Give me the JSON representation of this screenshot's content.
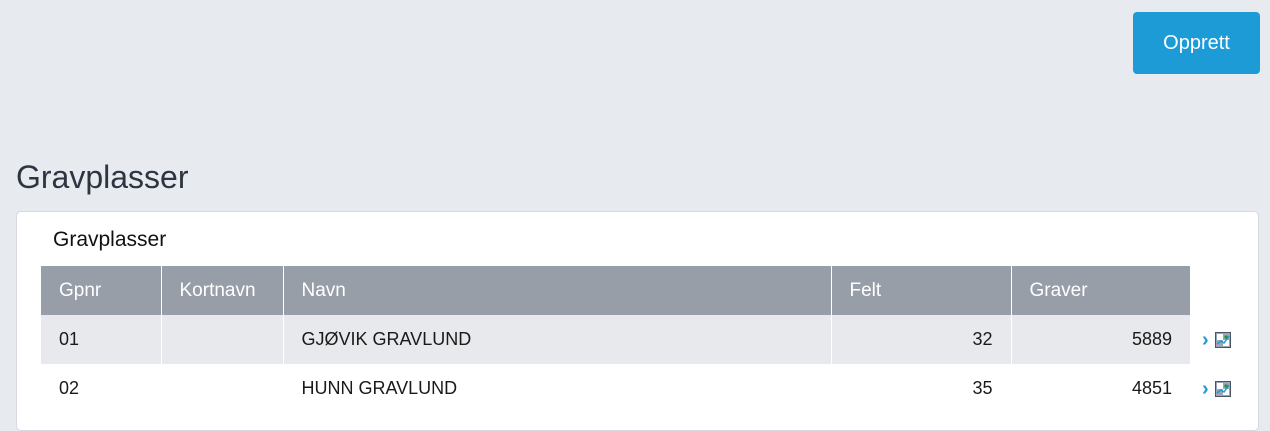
{
  "toolbar": {
    "create_label": "Opprett"
  },
  "page": {
    "title": "Gravplasser"
  },
  "panel": {
    "title": "Gravplasser"
  },
  "table": {
    "columns": [
      "Gpnr",
      "Kortnavn",
      "Navn",
      "Felt",
      "Graver"
    ],
    "rows": [
      {
        "gpnr": "01",
        "kortnavn": "",
        "navn": "GJØVIK GRAVLUND",
        "felt": "32",
        "graver": "5889"
      },
      {
        "gpnr": "02",
        "kortnavn": "",
        "navn": "HUNN GRAVLUND",
        "felt": "35",
        "graver": "4851"
      }
    ]
  },
  "icons": {
    "open_row": "chevron-right-icon",
    "map": "map-icon"
  },
  "colors": {
    "accent": "#1d9bd7",
    "header_bg": "#979ea8",
    "page_bg": "#e7eaef"
  }
}
